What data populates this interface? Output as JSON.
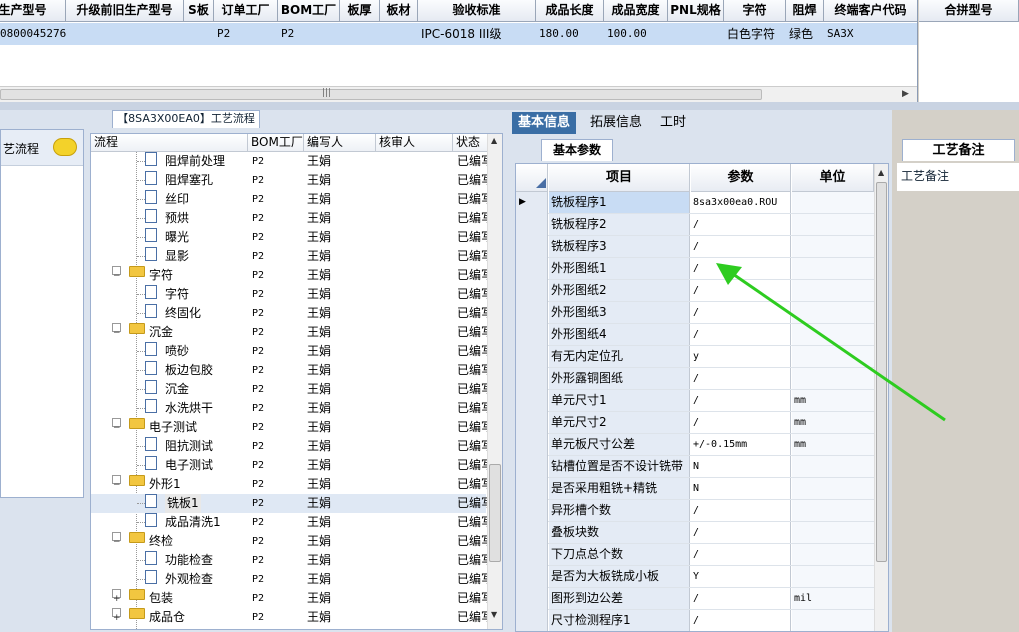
{
  "top_table": {
    "headers": [
      "生产型号",
      "升级前旧生产型号",
      "S板",
      "订单工厂",
      "BOM工厂",
      "板厚",
      "板材",
      "验收标准",
      "成品长度",
      "成品宽度",
      "PNL规格",
      "字符",
      "阻焊",
      "终端客户代码"
    ],
    "row": [
      "0800045276",
      "",
      "",
      "P2",
      "P2",
      "",
      "",
      "IPC-6018 III级",
      "180.00",
      "100.00",
      "",
      "白色字符",
      "绿色",
      "SA3X"
    ]
  },
  "top_right": {
    "header": "合拼型号"
  },
  "left_panel": {
    "title": "【8SA3X00EA0】工艺流程",
    "strip_label": "艺流程",
    "tree_headers": [
      "流程",
      "BOM工厂",
      "编写人",
      "核审人",
      "状态"
    ],
    "rows": [
      {
        "name": "阻焊前处理",
        "type": "item",
        "factory": "P2",
        "writer": "王娟",
        "status": "已编写"
      },
      {
        "name": "阻焊塞孔",
        "type": "item",
        "factory": "P2",
        "writer": "王娟",
        "status": "已编写"
      },
      {
        "name": "丝印",
        "type": "item",
        "factory": "P2",
        "writer": "王娟",
        "status": "已编写"
      },
      {
        "name": "预烘",
        "type": "item",
        "factory": "P2",
        "writer": "王娟",
        "status": "已编写"
      },
      {
        "name": "曝光",
        "type": "item",
        "factory": "P2",
        "writer": "王娟",
        "status": "已编写"
      },
      {
        "name": "显影",
        "type": "item",
        "factory": "P2",
        "writer": "王娟",
        "status": "已编写"
      },
      {
        "name": "字符",
        "type": "folder",
        "factory": "P2",
        "writer": "王娟",
        "status": "已编写"
      },
      {
        "name": "字符",
        "type": "item",
        "factory": "P2",
        "writer": "王娟",
        "status": "已编写"
      },
      {
        "name": "终固化",
        "type": "item",
        "factory": "P2",
        "writer": "王娟",
        "status": "已编写"
      },
      {
        "name": "沉金",
        "type": "folder",
        "factory": "P2",
        "writer": "王娟",
        "status": "已编写"
      },
      {
        "name": "喷砂",
        "type": "item",
        "factory": "P2",
        "writer": "王娟",
        "status": "已编写"
      },
      {
        "name": "板边包胶",
        "type": "item",
        "factory": "P2",
        "writer": "王娟",
        "status": "已编写"
      },
      {
        "name": "沉金",
        "type": "item",
        "factory": "P2",
        "writer": "王娟",
        "status": "已编写"
      },
      {
        "name": "水洗烘干",
        "type": "item",
        "factory": "P2",
        "writer": "王娟",
        "status": "已编写"
      },
      {
        "name": "电子测试",
        "type": "folder",
        "factory": "P2",
        "writer": "王娟",
        "status": "已编写"
      },
      {
        "name": "阻抗测试",
        "type": "item",
        "factory": "P2",
        "writer": "王娟",
        "status": "已编写"
      },
      {
        "name": "电子测试",
        "type": "item",
        "factory": "P2",
        "writer": "王娟",
        "status": "已编写"
      },
      {
        "name": "外形1",
        "type": "folder",
        "factory": "P2",
        "writer": "王娟",
        "status": "已编写"
      },
      {
        "name": "铣板1",
        "type": "item",
        "factory": "P2",
        "writer": "王娟",
        "status": "已编写",
        "selected": true
      },
      {
        "name": "成品清洗1",
        "type": "item",
        "factory": "P2",
        "writer": "王娟",
        "status": "已编写"
      },
      {
        "name": "终检",
        "type": "folder",
        "factory": "P2",
        "writer": "王娟",
        "status": "已编写"
      },
      {
        "name": "功能检查",
        "type": "item",
        "factory": "P2",
        "writer": "王娟",
        "status": "已编写"
      },
      {
        "name": "外观检查",
        "type": "item",
        "factory": "P2",
        "writer": "王娟",
        "status": "已编写"
      },
      {
        "name": "包装",
        "type": "folder-plus",
        "factory": "P2",
        "writer": "王娟",
        "status": "已编写"
      },
      {
        "name": "成品仓",
        "type": "folder-plus",
        "factory": "P2",
        "writer": "王娟",
        "status": "已编写"
      }
    ]
  },
  "right_panel": {
    "tabs": [
      "基本信息",
      "拓展信息",
      "工时"
    ],
    "subtab": "基本参数",
    "grid_headers": [
      "项目",
      "参数",
      "单位"
    ],
    "rows": [
      {
        "item": "铣板程序1",
        "param": "8sa3x00ea0.ROU",
        "unit": ""
      },
      {
        "item": "铣板程序2",
        "param": "/",
        "unit": ""
      },
      {
        "item": "铣板程序3",
        "param": "/",
        "unit": ""
      },
      {
        "item": "外形图纸1",
        "param": "/",
        "unit": ""
      },
      {
        "item": "外形图纸2",
        "param": "/",
        "unit": ""
      },
      {
        "item": "外形图纸3",
        "param": "/",
        "unit": ""
      },
      {
        "item": "外形图纸4",
        "param": "/",
        "unit": ""
      },
      {
        "item": "有无内定位孔",
        "param": "y",
        "unit": ""
      },
      {
        "item": "外形露铜图纸",
        "param": "/",
        "unit": ""
      },
      {
        "item": "单元尺寸1",
        "param": "/",
        "unit": "mm"
      },
      {
        "item": "单元尺寸2",
        "param": "/",
        "unit": "mm"
      },
      {
        "item": "单元板尺寸公差",
        "param": "+/-0.15mm",
        "unit": "mm"
      },
      {
        "item": "钻槽位置是否不设计铣带",
        "param": "N",
        "unit": ""
      },
      {
        "item": "是否采用粗铣+精铣",
        "param": "N",
        "unit": ""
      },
      {
        "item": "异形槽个数",
        "param": "/",
        "unit": ""
      },
      {
        "item": "叠板块数",
        "param": "/",
        "unit": ""
      },
      {
        "item": "下刀点总个数",
        "param": "/",
        "unit": ""
      },
      {
        "item": "是否为大板铣成小板",
        "param": "Y",
        "unit": ""
      },
      {
        "item": "图形到边公差",
        "param": "/",
        "unit": "mil"
      },
      {
        "item": "尺寸检测程序1",
        "param": "/",
        "unit": ""
      }
    ]
  },
  "notes": {
    "tab": "工艺备注",
    "label": "工艺备注"
  },
  "colors": {
    "tab_active": "#3a6ea5",
    "arrow": "#2ecc20",
    "selection": "#c8dcf4"
  }
}
